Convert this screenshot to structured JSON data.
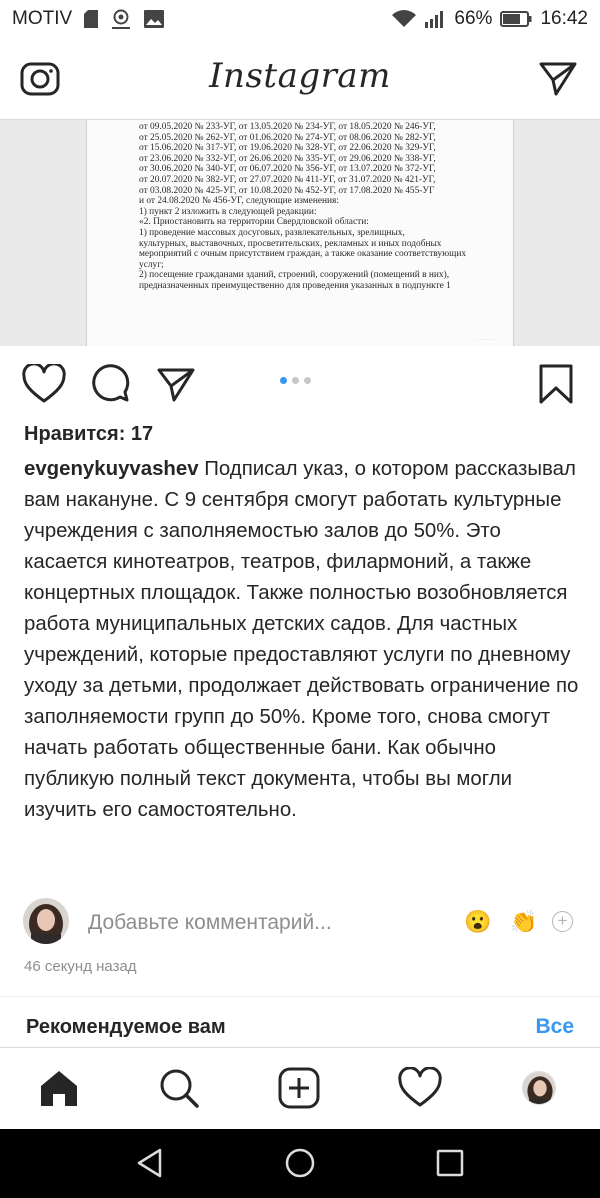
{
  "status_bar": {
    "carrier": "MOTIV",
    "battery_percent": "66%",
    "time": "16:42",
    "icons": [
      "sd-card-icon",
      "cast-icon",
      "image-icon",
      "wifi-icon",
      "signal-icon",
      "battery-icon"
    ]
  },
  "header": {
    "logo": "Instagram",
    "left_icon": "camera-icon",
    "right_icon": "direct-message-icon"
  },
  "document": {
    "lines": [
      "от 09.05.2020  № 233-УГ,  от  13.05.2020  № 234-УГ,  от  18.05.2020  № 246-УГ,",
      "от 25.05.2020  № 262-УГ,  от  01.06.2020  № 274-УГ,  от  08.06.2020  № 282-УГ,",
      "от 15.06.2020  № 317-УГ,  от  19.06.2020  № 328-УГ,  от  22.06.2020  № 329-УГ,",
      "от 23.06.2020  № 332-УГ,  от  26.06.2020  № 335-УГ,  от  29.06.2020  № 338-УГ,",
      "от 30.06.2020  № 340-УГ,  от  06.07.2020  № 356-УГ,  от  13.07.2020  № 372-УГ,",
      "от 20.07.2020  № 382-УГ,  от  27.07.2020  № 411-УГ,  от  31.07.2020  № 421-УГ,",
      "от 03.08.2020  № 425-УГ,  от  10.08.2020  № 452-УГ,  от  17.08.2020  № 455-УГ",
      "и от 24.08.2020 № 456-УГ, следующие изменения:",
      "      1) пункт 2 изложить в следующей редакции:",
      "      «2. Приостановить на территории Свердловской области:",
      "      1) проведение  массовых  досуговых,  развлекательных,  зрелищных,",
      "культурных,  выставочных,  просветительских,  рекламных  и  иных  подобных",
      "мероприятий с очным присутствием граждан, а также оказание соответствующих",
      "услуг;",
      "      2) посещение гражданами зданий, строений, сооружений (помещений в них),",
      "предназначенных  преимущественно  для  проведения  указанных  в  подпункте  1"
    ]
  },
  "post": {
    "likes": "Нравится: 17",
    "username": "evgenykuyvashev",
    "caption": "Подписал указ, о котором рассказывал вам накануне. С 9 сентября смогут работать культурные учреждения с заполняемостью залов до 50%. Это касается кинотеатров, театров, филармоний, а также концертных площадок. Также полностью возобновляется работа муниципальных детских садов. Для частных учреждений, которые предоставляют услуги по дневному уходу за детьми, продолжает действовать ограничение по заполняемости групп до 50%. Кроме того, снова смогут начать работать общественные бани. Как обычно публикую полный текст документа, чтобы вы могли изучить его самостоятельно.",
    "carousel": {
      "count": 3,
      "active": 1
    },
    "comment_placeholder": "Добавьте комментарий...",
    "quick_emojis": [
      "😮",
      "👏"
    ],
    "timestamp": "46 секунд назад"
  },
  "recommended": {
    "title": "Рекомендуемое вам",
    "see_all": "Все"
  },
  "colors": {
    "accent": "#3897f0",
    "text": "#262626",
    "muted": "#8e8e8e"
  }
}
